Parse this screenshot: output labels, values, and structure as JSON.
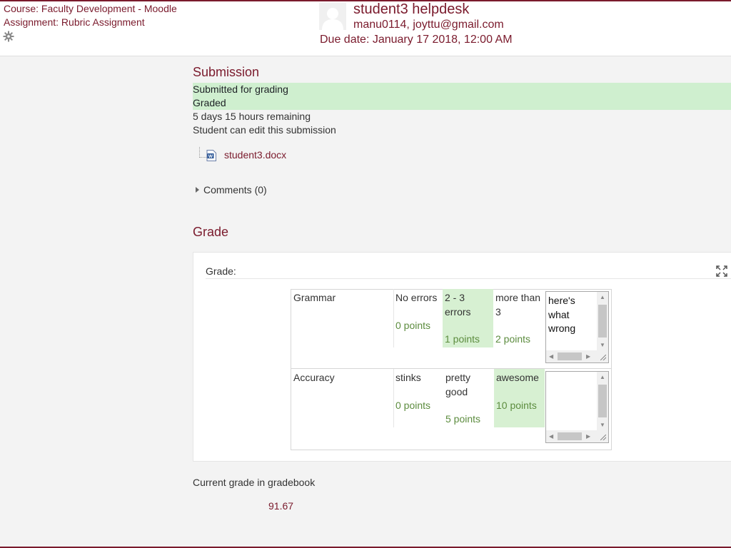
{
  "header": {
    "course": "Course: Faculty Development - Moodle",
    "assignment": "Assignment: Rubric Assignment",
    "user_name": "student3 helpdesk",
    "user_emails": "manu0114, joyttu@gmail.com",
    "due_date": "Due date: January 17 2018, 12:00 AM"
  },
  "submission": {
    "heading": "Submission",
    "status_submitted": "Submitted for grading",
    "status_graded": "Graded",
    "time_remaining": "5 days 15 hours remaining",
    "edit_status": "Student can edit this submission",
    "file_name": "student3.docx",
    "comments": "Comments (0)"
  },
  "grade": {
    "heading": "Grade",
    "label": "Grade:",
    "current_label": "Current grade in gradebook",
    "current_value": "91.67"
  },
  "rubric": {
    "criteria": [
      {
        "name": "Grammar",
        "levels": [
          {
            "definition": "No errors",
            "points": "0 points",
            "selected": false
          },
          {
            "definition": "2 - 3 errors",
            "points": "1 points",
            "selected": true
          },
          {
            "definition": "more than 3",
            "points": "2 points",
            "selected": false
          }
        ],
        "remark": "here's what wrong"
      },
      {
        "name": "Accuracy",
        "levels": [
          {
            "definition": "stinks",
            "points": "0 points",
            "selected": false
          },
          {
            "definition": "pretty good",
            "points": "5 points",
            "selected": false
          },
          {
            "definition": "awesome",
            "points": "10 points",
            "selected": true
          }
        ],
        "remark": ""
      }
    ]
  },
  "colors": {
    "accent": "#7a1a2c",
    "status_ok": "#cfefcf",
    "selected_level": "#d7f0d2",
    "points_green": "#5c8c3e"
  },
  "icons": {
    "gear": "gear-icon",
    "file": "word-document-icon",
    "expand": "fullscreen-icon",
    "comments": "triangle-right-icon"
  }
}
